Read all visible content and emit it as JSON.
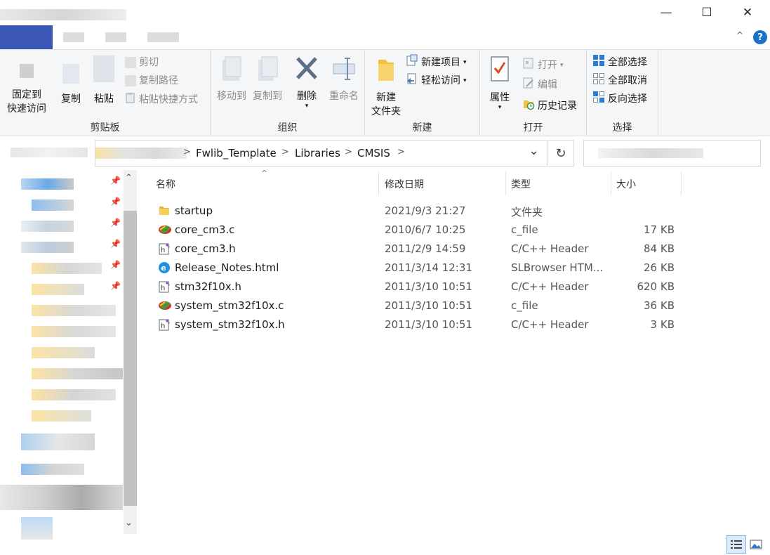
{
  "window": {
    "minimize": "—",
    "maximize": "☐",
    "close": "✕"
  },
  "ribbon": {
    "clipboard": {
      "name": "剪贴板",
      "pin_line1": "固定到",
      "pin_line2": "快速访问",
      "copy": "复制",
      "paste": "粘贴",
      "cut": "剪切",
      "copy_path": "复制路径",
      "paste_shortcut": "粘贴快捷方式"
    },
    "organize": {
      "name": "组织",
      "move_to": "移动到",
      "copy_to": "复制到",
      "delete": "删除",
      "rename": "重命名"
    },
    "new": {
      "name": "新建",
      "new_folder_line1": "新建",
      "new_folder_line2": "文件夹",
      "new_item": "新建项目",
      "easy_access": "轻松访问"
    },
    "open": {
      "name": "打开",
      "properties": "属性",
      "open": "打开",
      "edit": "编辑",
      "history": "历史记录"
    },
    "select": {
      "name": "选择",
      "select_all": "全部选择",
      "select_none": "全部取消",
      "invert": "反向选择"
    }
  },
  "address": {
    "crumbs": [
      "Fwlib_Template",
      "Libraries",
      "CMSIS"
    ],
    "separator": ">",
    "dropdown": "⌄",
    "refresh": "↻"
  },
  "columns": {
    "name": "名称",
    "date": "修改日期",
    "type": "类型",
    "size": "大小",
    "sort_indicator": "^"
  },
  "files": [
    {
      "name": "startup",
      "date": "2021/9/3 21:27",
      "type": "文件夹",
      "size": "",
      "icon": "folder-icon"
    },
    {
      "name": "core_cm3.c",
      "date": "2010/6/7 10:25",
      "type": "c_file",
      "size": "17 KB",
      "icon": "c-file-icon"
    },
    {
      "name": "core_cm3.h",
      "date": "2011/2/9 14:59",
      "type": "C/C++ Header",
      "size": "84 KB",
      "icon": "header-file-icon"
    },
    {
      "name": "Release_Notes.html",
      "date": "2011/3/14 12:31",
      "type": "SLBrowser HTM...",
      "size": "26 KB",
      "icon": "browser-html-icon"
    },
    {
      "name": "stm32f10x.h",
      "date": "2011/3/10 10:51",
      "type": "C/C++ Header",
      "size": "620 KB",
      "icon": "header-file-icon"
    },
    {
      "name": "system_stm32f10x.c",
      "date": "2011/3/10 10:51",
      "type": "c_file",
      "size": "36 KB",
      "icon": "c-file-icon"
    },
    {
      "name": "system_stm32f10x.h",
      "date": "2011/3/10 10:51",
      "type": "C/C++ Header",
      "size": "3 KB",
      "icon": "header-file-icon"
    }
  ],
  "nav": {
    "pin_glyph": "📌",
    "scroll_up": "⌃",
    "scroll_down": "⌄"
  },
  "help": "?",
  "collapse_ribbon": "^",
  "colors": {
    "accent": "#1a73c9",
    "folder": "#f4c042",
    "delete": "#5b6f86"
  }
}
